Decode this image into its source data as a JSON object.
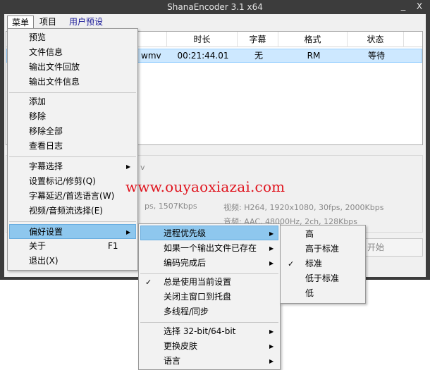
{
  "window": {
    "title": "ShanaEncoder 3.1 x64",
    "minimize": "_",
    "close": "X"
  },
  "menubar": {
    "items": [
      "菜单",
      "项目",
      "用户预设"
    ]
  },
  "filelist": {
    "headers": [
      "时长",
      "字幕",
      "格式",
      "状态"
    ],
    "row": {
      "name_partial": "wmv",
      "duration": "00:21:44.01",
      "subtitle": "无",
      "format": "RM",
      "status": "等待"
    }
  },
  "info": {
    "left_partial": "v",
    "left_bitrate_partial": "ps, 1507Kbps",
    "video": "视频: H264, 1920x1080, 30fps, 2000Kbps",
    "audio": "音频: AAC, 48000Hz, 2ch, 128Kbps"
  },
  "start_button": "开始",
  "watermark": "www.ouyaoxiazai.com",
  "main_menu": {
    "items": [
      {
        "label": "预览"
      },
      {
        "label": "文件信息"
      },
      {
        "label": "输出文件回放"
      },
      {
        "label": "输出文件信息"
      },
      {
        "label": "添加"
      },
      {
        "label": "移除"
      },
      {
        "label": "移除全部"
      },
      {
        "label": "查看日志"
      },
      {
        "label": "字幕选择",
        "submenu": true
      },
      {
        "label": "设置标记/修剪(Q)"
      },
      {
        "label": "字幕延迟/首选语言(W)"
      },
      {
        "label": "视频/音频流选择(E)"
      },
      {
        "label": "偏好设置",
        "submenu": true,
        "highlighted": true
      },
      {
        "label": "关于",
        "shortcut": "F1"
      },
      {
        "label": "退出(X)"
      }
    ]
  },
  "preferences_menu": {
    "items": [
      {
        "label": "进程优先级",
        "submenu": true,
        "highlighted": true
      },
      {
        "label": "如果一个输出文件已存在",
        "submenu": true
      },
      {
        "label": "编码完成后",
        "submenu": true
      },
      {
        "label": "总是使用当前设置",
        "checked": true
      },
      {
        "label": "关闭主窗口到托盘"
      },
      {
        "label": "多线程/同步"
      },
      {
        "label": "选择 32-bit/64-bit",
        "submenu": true
      },
      {
        "label": "更换皮肤",
        "submenu": true
      },
      {
        "label": "语言",
        "submenu": true
      }
    ]
  },
  "priority_menu": {
    "items": [
      {
        "label": "高"
      },
      {
        "label": "高于标准"
      },
      {
        "label": "标准",
        "checked": true
      },
      {
        "label": "低于标准"
      },
      {
        "label": "低"
      }
    ]
  },
  "icons": {
    "submenu_arrow": "▶",
    "check": "✓"
  },
  "colors": {
    "title_bar": "#3c3c3c",
    "menu_highlight": "#8ec7ee",
    "row_selected": "#cde8ff",
    "watermark": "#e0141e"
  }
}
